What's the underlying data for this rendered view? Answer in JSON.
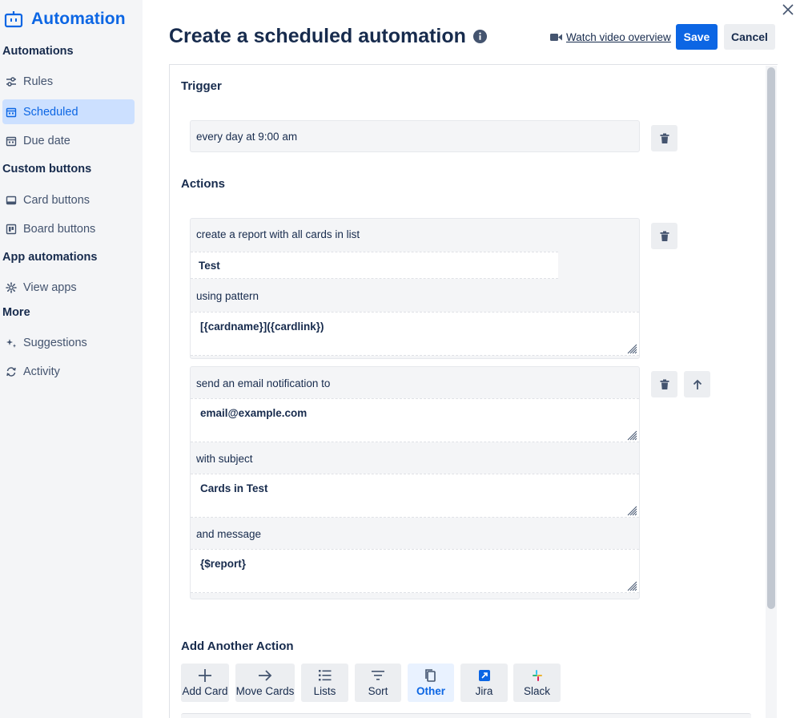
{
  "sidebar": {
    "brand_title": "Automation",
    "sections": {
      "automations": "Automations",
      "custom_buttons": "Custom buttons",
      "app_automations": "App automations",
      "more": "More"
    },
    "items": {
      "rules": "Rules",
      "scheduled": "Scheduled",
      "due_date": "Due date",
      "card_buttons": "Card buttons",
      "board_buttons": "Board buttons",
      "view_apps": "View apps",
      "suggestions": "Suggestions",
      "activity": "Activity"
    },
    "active_item": "scheduled"
  },
  "header": {
    "title": "Create a scheduled automation",
    "watch_video": "Watch video overview",
    "save": "Save",
    "cancel": "Cancel"
  },
  "trigger": {
    "heading": "Trigger",
    "text": "every day at 9:00 am"
  },
  "actions": {
    "heading": "Actions",
    "report": {
      "label": "create a report with all cards in list",
      "list_value": "Test",
      "pattern_label": "using pattern",
      "pattern_value": "[{cardname}]({cardlink})"
    },
    "email": {
      "label": "send an email notification to",
      "to_value": "email@example.com",
      "subject_label": "with subject",
      "subject_value": "Cards in Test",
      "message_label": "and message",
      "message_value": "{$report}"
    }
  },
  "add_another": {
    "heading": "Add Another Action",
    "tiles": {
      "add_card": "Add Card",
      "move_cards": "Move Cards",
      "lists": "Lists",
      "sort": "Sort",
      "other": "Other",
      "jira": "Jira",
      "slack": "Slack"
    },
    "active_tile": "other"
  },
  "colors": {
    "accent": "#0c66e4",
    "sidebar_bg": "#f4f5f7",
    "active_item_bg": "#cce0ff",
    "text": "#172b4d"
  }
}
